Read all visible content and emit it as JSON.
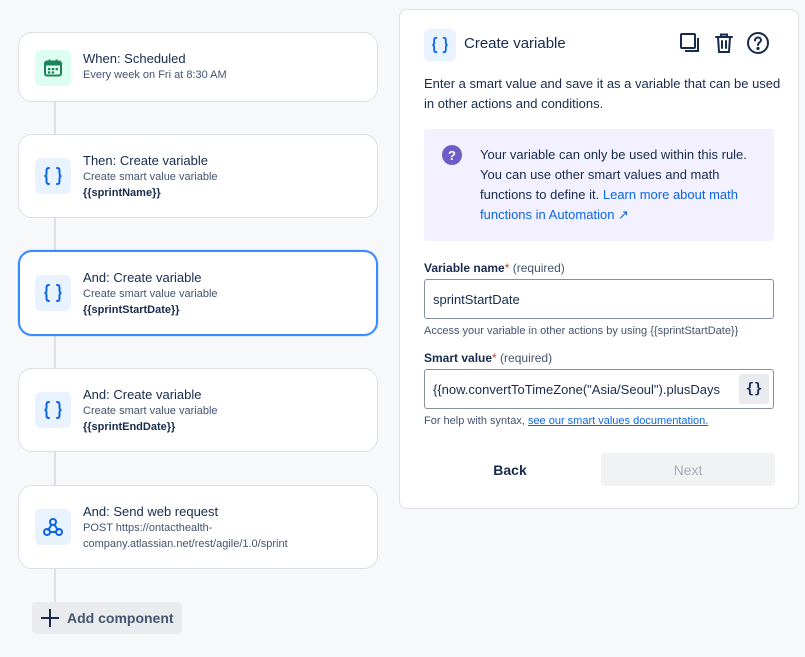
{
  "flow": {
    "steps": [
      {
        "title": "When: Scheduled",
        "subtitle": "Every week on Fri at 8:30 AM",
        "detail": "",
        "icon": "calendar-icon"
      },
      {
        "title": "Then: Create variable",
        "subtitle": "Create smart value variable",
        "detail": "{{sprintName}}",
        "icon": "braces-icon"
      },
      {
        "title": "And: Create variable",
        "subtitle": "Create smart value variable",
        "detail": "{{sprintStartDate}}",
        "icon": "braces-icon"
      },
      {
        "title": "And: Create variable",
        "subtitle": "Create smart value variable",
        "detail": "{{sprintEndDate}}",
        "icon": "braces-icon"
      },
      {
        "title": "And: Send web request",
        "subtitle": "POST https://ontacthealth-company.atlassian.net/rest/agile/1.0/sprint",
        "detail": "",
        "icon": "webhook-icon"
      }
    ],
    "add_component_label": "Add component"
  },
  "panel": {
    "title": "Create variable",
    "description": "Enter a smart value and save it as a variable that can be used in other actions and conditions.",
    "info": {
      "text": "Your variable can only be used within this rule. You can use other smart values and math functions to define it. ",
      "link": "Learn more about math functions in Automation ↗"
    },
    "variable_name": {
      "label": "Variable name",
      "asterisk": "*",
      "required": " (required)",
      "value": "sprintStartDate",
      "help": "Access your variable in other actions by using {{sprintStartDate}}"
    },
    "smart_value": {
      "label": "Smart value",
      "asterisk": "*",
      "required": " (required)",
      "value": "{{now.convertToTimeZone(\"Asia/Seoul\").plusDays",
      "button": "{}",
      "help_prefix": "For help with syntax, ",
      "help_link": "see our smart values documentation."
    },
    "back_label": "Back",
    "next_label": "Next"
  },
  "colors": {
    "accent": "#0c66e4",
    "selected_border": "#388bff",
    "info_bg": "#f3f0ff"
  }
}
